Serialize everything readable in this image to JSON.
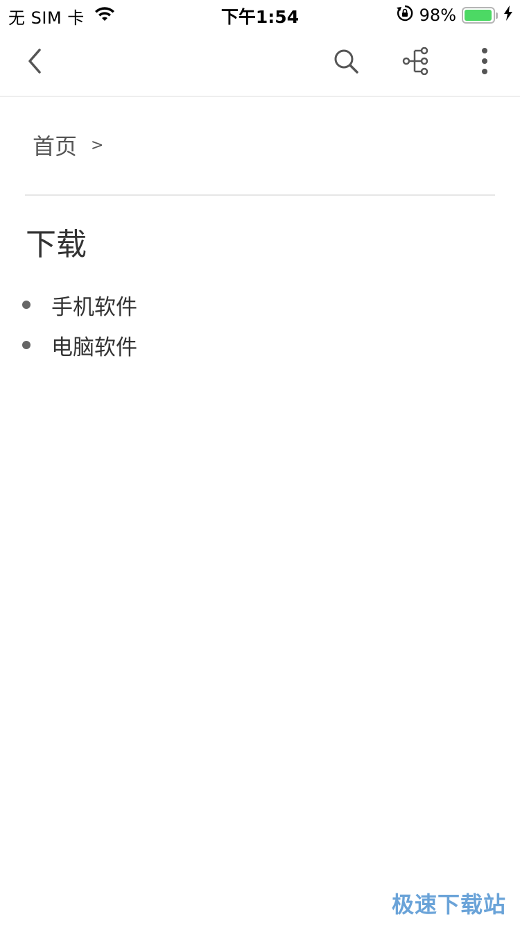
{
  "status_bar": {
    "carrier": "无 SIM 卡",
    "time": "下午1:54",
    "battery_percent_text": "98%",
    "battery_level": 0.98,
    "icons": [
      "wifi-icon",
      "rotation-lock-icon",
      "battery-icon",
      "charging-bolt-icon"
    ]
  },
  "app_bar": {
    "icons": [
      "back-arrow-icon",
      "search-icon",
      "tree-structure-icon",
      "more-vertical-icon"
    ]
  },
  "breadcrumb": {
    "home": "首页",
    "separator": ">"
  },
  "page": {
    "title": "下载",
    "items": [
      {
        "label": "手机软件"
      },
      {
        "label": "电脑软件"
      }
    ]
  },
  "watermark": "极速下载站",
  "colors": {
    "battery_green": "#4cd964",
    "watermark_blue": "#6aa3d8",
    "icon_gray": "#555555"
  }
}
